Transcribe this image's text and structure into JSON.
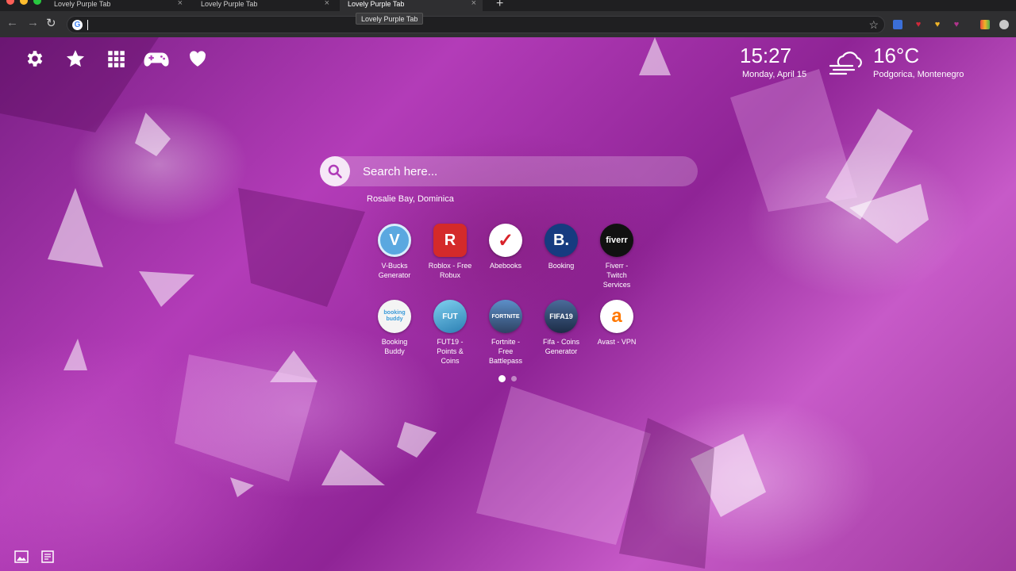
{
  "browser": {
    "tabs": [
      {
        "label": "Lovely Purple Tab",
        "active": false
      },
      {
        "label": "Lovely Purple Tab",
        "active": false
      },
      {
        "label": "Lovely Purple Tab",
        "active": true
      }
    ],
    "tooltip": "Lovely Purple Tab",
    "new_tab_glyph": "+",
    "close_glyph": "×",
    "address_value": "",
    "extension_colors": [
      "#3b6fd8",
      "#d0283a",
      "#f0b428",
      "#b0348c",
      "#e84a3c"
    ]
  },
  "top_icons": [
    "gear-icon",
    "star-icon",
    "apps-grid-icon",
    "gamepad-icon",
    "heart-icon"
  ],
  "clock": {
    "time": "15:27",
    "date": "Monday, April 15"
  },
  "weather": {
    "icon": "cloud-wind-icon",
    "temperature": "16°C",
    "location": "Podgorica, Montenegro"
  },
  "search": {
    "placeholder": "Search here...",
    "wallpaper_location": "Rosalie Bay, Dominica"
  },
  "tiles": [
    {
      "label": "V-Bucks Generator",
      "icon_text": "V",
      "bg": "#5aa8e0",
      "fg": "#ffffff"
    },
    {
      "label": "Roblox - Free Robux",
      "icon_text": "R",
      "bg": "#d42a2a",
      "fg": "#ffffff"
    },
    {
      "label": "Abebooks",
      "icon_text": "✓",
      "bg": "#ffffff",
      "fg": "#d8232a"
    },
    {
      "label": "Booking",
      "icon_text": "B.",
      "bg": "#163b80",
      "fg": "#ffffff"
    },
    {
      "label": "Fiverr - Twitch Services",
      "icon_text": "fiverr",
      "bg": "#111111",
      "fg": "#ffffff"
    },
    {
      "label": "Booking Buddy",
      "icon_text": "booking buddy",
      "bg": "#f4f4f4",
      "fg": "#3a9ad9"
    },
    {
      "label": "FUT19 - Points & Coins",
      "icon_text": "FUT",
      "bg": "#3e9ecf",
      "fg": "#ffffff"
    },
    {
      "label": "Fortnite - Free Battlepass",
      "icon_text": "FORTNITE",
      "bg": "#3b5f8a",
      "fg": "#ffffff"
    },
    {
      "label": "Fifa - Coins Generator",
      "icon_text": "FIFA19",
      "bg": "#2c3e5c",
      "fg": "#ffffff"
    },
    {
      "label": "Avast - VPN",
      "icon_text": "a",
      "bg": "#ffffff",
      "fg": "#ff7800"
    }
  ],
  "pager": {
    "pages": 2,
    "current": 1
  }
}
